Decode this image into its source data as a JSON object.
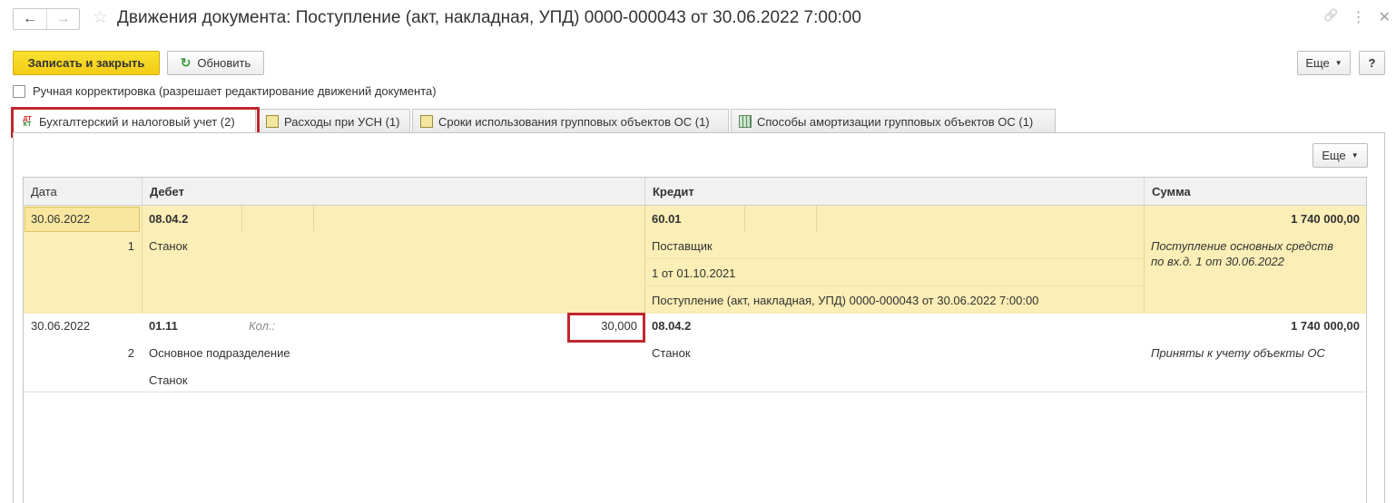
{
  "window": {
    "title": "Движения документа: Поступление (акт, накладная, УПД) 0000-000043 от 30.06.2022 7:00:00",
    "nav_back": "←",
    "nav_forward": "→",
    "star": "☆",
    "link_icon": "🔗",
    "more_icon": "⋮",
    "close_icon": "✕"
  },
  "toolbar": {
    "save_close_label": "Записать и закрыть",
    "refresh_label": "Обновить",
    "more_label": "Еще",
    "help_label": "?"
  },
  "manual_correction": {
    "label": "Ручная корректировка (разрешает редактирование движений документа)",
    "checked": false
  },
  "tabs": [
    {
      "label": "Бухгалтерский и налоговый учет (2)",
      "icon": "dt-kt-icon",
      "active": true
    },
    {
      "label": "Расходы при УСН (1)",
      "icon": "register-icon",
      "active": false
    },
    {
      "label": "Сроки использования групповых объектов ОС (1)",
      "icon": "register-icon",
      "active": false
    },
    {
      "label": "Способы амортизации групповых объектов ОС (1)",
      "icon": "table-icon",
      "active": false
    }
  ],
  "icon_labels": {
    "dt": "ДТ",
    "kt": "КТ"
  },
  "panel": {
    "more_label": "Еще"
  },
  "table": {
    "columns": [
      "Дата",
      "Дебет",
      "Кредит",
      "Сумма"
    ],
    "rows": [
      {
        "date": "30.06.2022",
        "num": "1",
        "debit_account": "08.04.2",
        "debit_sub": [
          "Станок"
        ],
        "qty_label": "",
        "qty_value": "",
        "credit_account": "60.01",
        "credit_sub": [
          "Поставщик",
          "1 от 01.10.2021",
          "Поступление (акт, накладная, УПД) 0000-000043 от 30.06.2022 7:00:00"
        ],
        "sum": "1 740 000,00",
        "content": "Поступление основных средств по вх.д. 1 от 30.06.2022",
        "content_lines": [
          "Поступление основных средств",
          "по вх.д. 1 от 30.06.2022"
        ]
      },
      {
        "date": "30.06.2022",
        "num": "2",
        "debit_account": "01.11",
        "debit_sub": [
          "Основное подразделение",
          "Станок"
        ],
        "qty_label": "Кол.:",
        "qty_value": "30,000",
        "credit_account": "08.04.2",
        "credit_sub": [
          "Станок"
        ],
        "sum": "1 740 000,00",
        "content": "Приняты к учету объекты ОС",
        "content_lines": [
          "Приняты к учету объекты ОС"
        ]
      }
    ]
  },
  "highlight_color": "#c0272d",
  "selected_row_color": "#fbeeb6",
  "primary_button_color": "#f4d41c"
}
